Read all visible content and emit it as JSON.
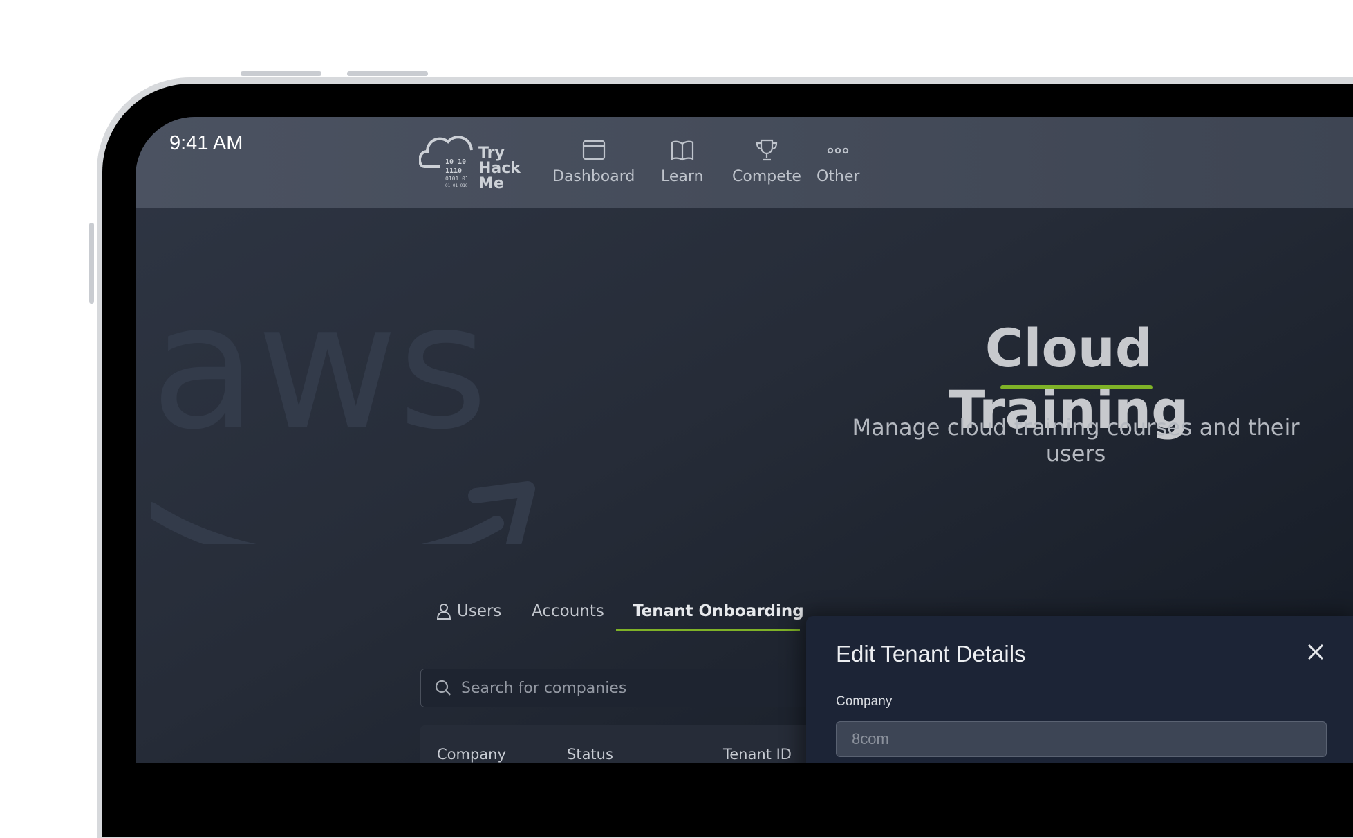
{
  "status_bar": {
    "time": "9:41 AM"
  },
  "brand": {
    "line1": "Try",
    "line2": "Hack",
    "line3": "Me"
  },
  "nav": {
    "items": [
      {
        "label": "Dashboard",
        "icon": "dashboard-icon"
      },
      {
        "label": "Learn",
        "icon": "book-icon"
      },
      {
        "label": "Compete",
        "icon": "trophy-icon"
      },
      {
        "label": "Other",
        "icon": "more-icon"
      }
    ]
  },
  "hero": {
    "title": "Cloud Training",
    "subtitle": "Manage cloud training courses and their users",
    "watermark": "aws",
    "accent_color": "#7fb227"
  },
  "tabs": [
    {
      "label": "Users",
      "icon": "user-icon"
    },
    {
      "label": "Accounts"
    },
    {
      "label": "Tenant Onboarding",
      "active": true
    }
  ],
  "search": {
    "placeholder": "Search for companies"
  },
  "table": {
    "columns": [
      "Company",
      "Status",
      "Tenant ID"
    ]
  },
  "modal": {
    "title": "Edit Tenant Details",
    "company_label": "Company",
    "company_value": "8com"
  }
}
